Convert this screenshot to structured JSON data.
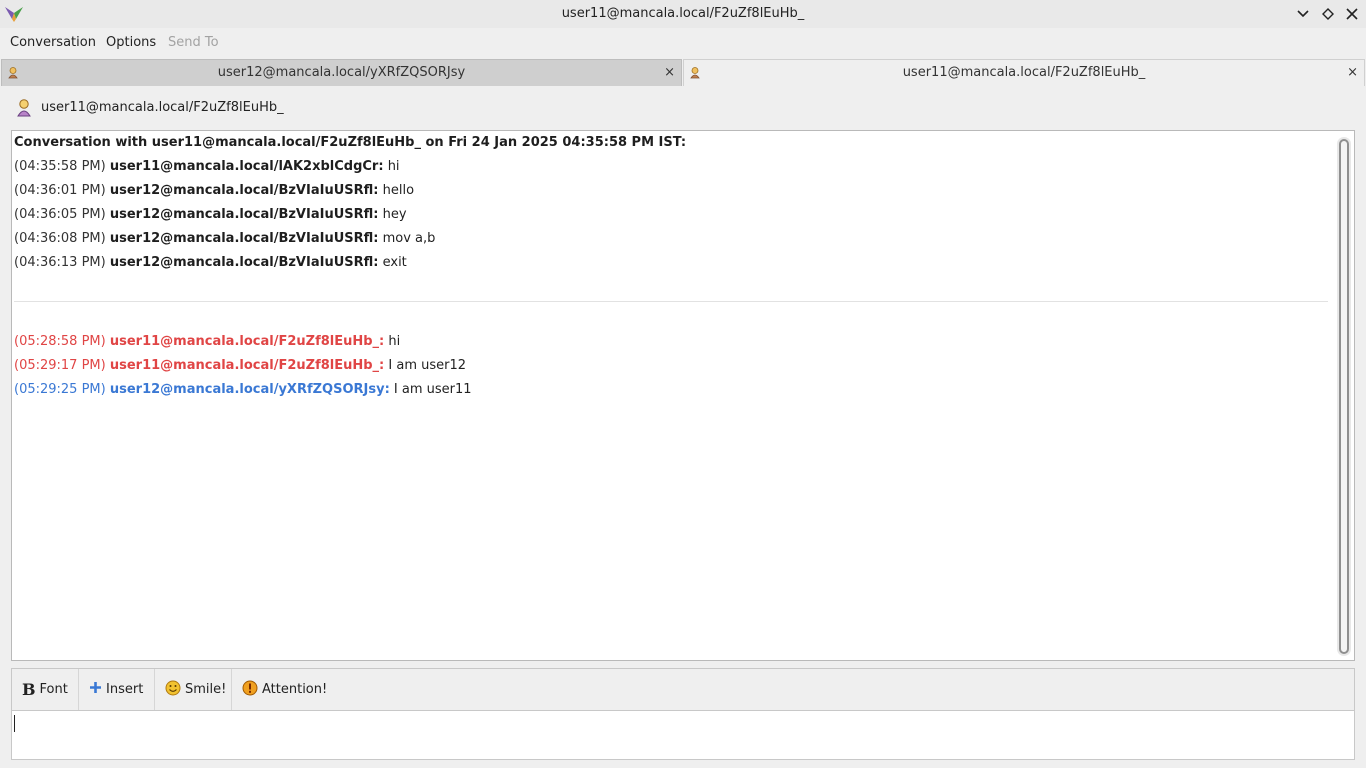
{
  "window": {
    "title": "user11@mancala.local/F2uZf8lEuHb_",
    "logo_icon": "pidgin-logo-icon",
    "controls": [
      "chevron-down-icon",
      "diamond-icon",
      "close-icon"
    ]
  },
  "menubar": {
    "conversation": "Conversation",
    "options": "Options",
    "send_to": "Send To"
  },
  "tabs": [
    {
      "label": "user12@mancala.local/yXRfZQSORJsy",
      "active": false,
      "close": "×"
    },
    {
      "label": "user11@mancala.local/F2uZf8lEuHb_",
      "active": true,
      "close": "×"
    }
  ],
  "buddy": {
    "name": "user11@mancala.local/F2uZf8lEuHb_",
    "icon": "person-icon"
  },
  "conversation": {
    "header": "Conversation with user11@mancala.local/F2uZf8lEuHb_ on Fri 24 Jan 2025 04:35:58 PM IST:",
    "messages_before": [
      {
        "time": "(04:35:58 PM)",
        "sender": "user11@mancala.local/lAK2xblCdgCr:",
        "text": "hi"
      },
      {
        "time": "(04:36:01 PM)",
        "sender": "user12@mancala.local/BzVIaIuUSRfl:",
        "text": "hello"
      },
      {
        "time": "(04:36:05 PM)",
        "sender": "user12@mancala.local/BzVIaIuUSRfl:",
        "text": "hey"
      },
      {
        "time": "(04:36:08 PM)",
        "sender": "user12@mancala.local/BzVIaIuUSRfl:",
        "text": "mov a,b"
      },
      {
        "time": "(04:36:13 PM)",
        "sender": "user12@mancala.local/BzVIaIuUSRfl:",
        "text": "exit"
      }
    ],
    "messages_after": [
      {
        "time": "(05:28:58 PM)",
        "sender": "user11@mancala.local/F2uZf8lEuHb_:",
        "text": "hi",
        "color": "#e04545"
      },
      {
        "time": "(05:29:17 PM)",
        "sender": "user11@mancala.local/F2uZf8lEuHb_:",
        "text": "I am user12",
        "color": "#e04545"
      },
      {
        "time": "(05:29:25 PM)",
        "sender": "user12@mancala.local/yXRfZQSORJsy:",
        "text": "I am user11",
        "color": "#3a78d4"
      }
    ]
  },
  "toolbar": {
    "font_label": "Font",
    "font_glyph": "B",
    "insert_label": "Insert",
    "smile_label": "Smile!",
    "attention_label": "Attention!"
  },
  "input": {
    "value": ""
  }
}
